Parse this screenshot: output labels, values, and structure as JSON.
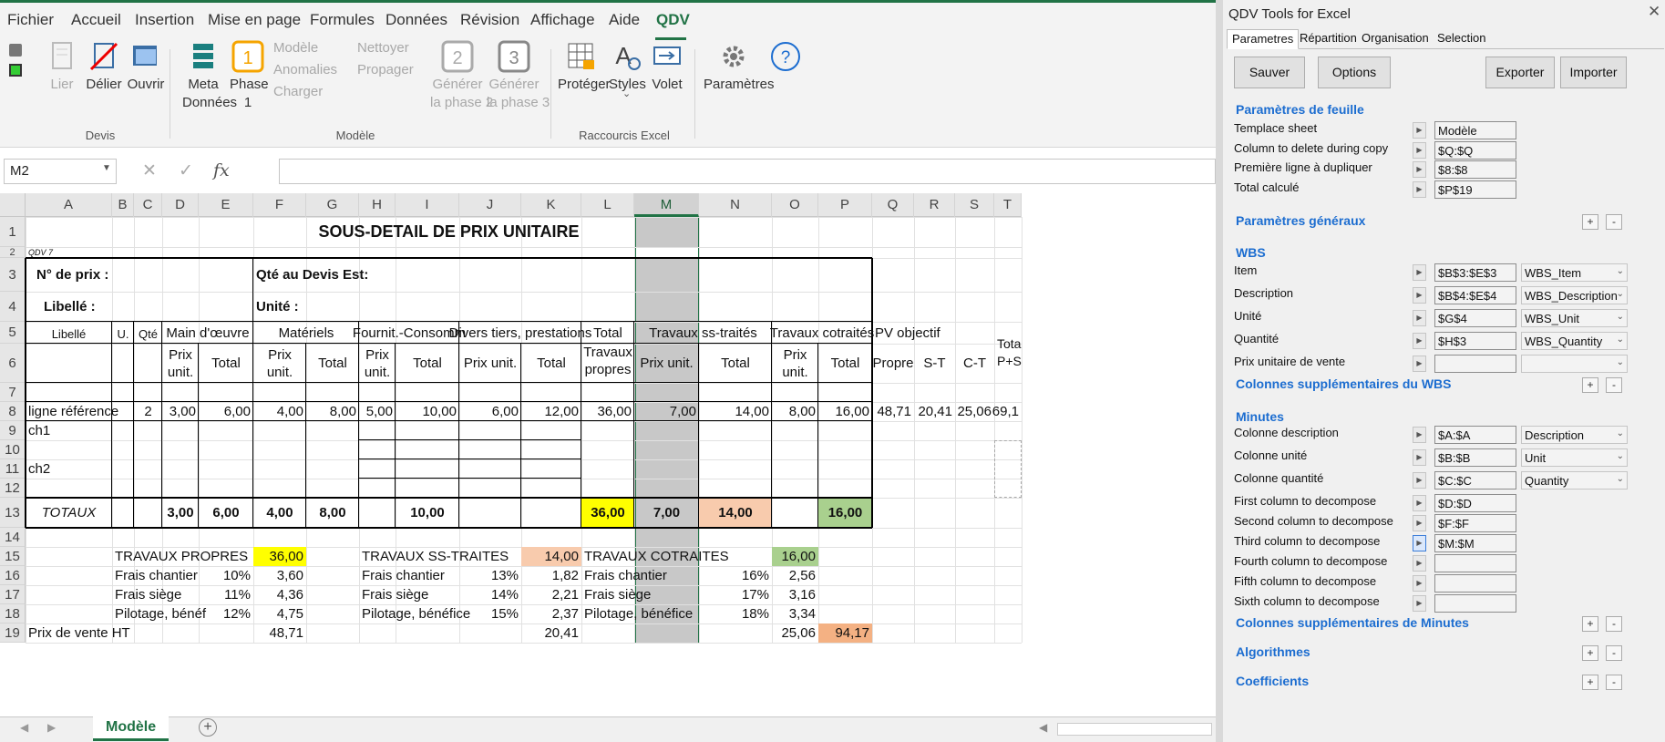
{
  "menu": [
    "Fichier",
    "Accueil",
    "Insertion",
    "Mise en page",
    "Formules",
    "Données",
    "Révision",
    "Affichage",
    "Aide",
    "QDV"
  ],
  "ribbon": {
    "lier": "Lier",
    "delier": "Délier",
    "ouvrir": "Ouvrir",
    "meta": "Meta",
    "donnees": "Données",
    "phase": "Phase",
    "phase_num": "1",
    "phase_icon_num": "1",
    "modele": "Modèle",
    "anomalies": "Anomalies",
    "charger": "Charger",
    "nettoyer": "Nettoyer",
    "propager": "Propager",
    "gen2_a": "Générer",
    "gen2_b": "la phase 2",
    "gen2_icon": "2",
    "gen3_a": "Générer",
    "gen3_b": "la phase 3",
    "gen3_icon": "3",
    "proteger": "Protéger",
    "styles": "Styles",
    "volet": "Volet",
    "parametres": "Paramètres",
    "grp_devis": "Devis",
    "grp_modele": "Modèle",
    "grp_raccourcis": "Raccourcis Excel"
  },
  "formula": {
    "name_box": "M2",
    "fx": "fx",
    "value": ""
  },
  "columns": [
    "A",
    "B",
    "C",
    "D",
    "E",
    "F",
    "G",
    "H",
    "I",
    "J",
    "K",
    "L",
    "M",
    "N",
    "O",
    "P",
    "Q",
    "R",
    "S",
    "T"
  ],
  "rows": [
    "1",
    "2",
    "3",
    "4",
    "5",
    "6",
    "7",
    "8",
    "9",
    "10",
    "11",
    "12",
    "13",
    "14",
    "15",
    "16",
    "17",
    "18",
    "19"
  ],
  "sheet": {
    "title": "SOUS-DETAIL DE PRIX UNITAIRE",
    "qdv": "QDV 7",
    "no_prix": "N° de prix :",
    "qte_devis": "Qté au Devis Est:",
    "libelle_lbl": "Libellé :",
    "unite_lbl": "Unité :",
    "h_main": "Main d'œuvre",
    "h_mat": "Matériels",
    "h_fourn": "Fournit.-Consomm",
    "h_divers": "Divers tiers, prestations",
    "h_total": "Total",
    "h_total2": "Travaux propres",
    "h_travaux_st": "Travaux ss-traités",
    "h_travaux_cot": "Travaux cotraités",
    "h_pv": "PV objectif",
    "h_libelle": "Libellé",
    "h_u": "U.",
    "h_qte": "Qté",
    "h_prix_unit": "Prix unit.",
    "h_total_col": "Total",
    "h_propre": "Propre",
    "h_st": "S-T",
    "h_ct": "C-T",
    "h_tot_ps": "Tota P+S",
    "row8": [
      "ligne référence",
      "2",
      "3,00",
      "6,00",
      "4,00",
      "8,00",
      "5,00",
      "10,00",
      "6,00",
      "12,00",
      "36,00",
      "7,00",
      "14,00",
      "8,00",
      "16,00",
      "48,71",
      "20,41",
      "25,06",
      "69,1"
    ],
    "ch1": "ch1",
    "ch2": "ch2",
    "totaux": "TOTAUX",
    "row13": [
      "3,00",
      "6,00",
      "4,00",
      "8,00",
      "10,00",
      "36,00",
      "7,00",
      "14,00",
      "16,00"
    ],
    "s_tp": "TRAVAUX PROPRES",
    "s_tp_val": "36,00",
    "s_tst": "TRAVAUX SS-TRAITES",
    "s_tst_val": "14,00",
    "s_tct": "TRAVAUX COTRAITES",
    "s_tct_val": "16,00",
    "frais_chantier": "Frais chantier",
    "frais_siege": "Frais siège",
    "pilotage1": "Pilotage, bénéf",
    "pilotage2": "Pilotage, bénéfice",
    "p16": [
      "10%",
      "3,60",
      "13%",
      "1,82",
      "16%",
      "2,56"
    ],
    "p17": [
      "11%",
      "4,36",
      "14%",
      "2,21",
      "17%",
      "3,16"
    ],
    "p18": [
      "12%",
      "4,75",
      "15%",
      "2,37",
      "18%",
      "3,34"
    ],
    "pv_ht": "Prix de vente HT",
    "pv1": "48,71",
    "pv2": "20,41",
    "pv3": "25,06",
    "pv_total": "94,17"
  },
  "tab": {
    "name": "Modèle"
  },
  "panel": {
    "title": "QDV Tools for Excel",
    "tabs": [
      "Parametres",
      "Répartition",
      "Organisation",
      "Selection"
    ],
    "btn_sauver": "Sauver",
    "btn_options": "Options",
    "btn_exporter": "Exporter",
    "btn_importer": "Importer",
    "sec_feuille": "Paramètres de feuille",
    "feuille": [
      [
        "Templace sheet",
        "Modèle"
      ],
      [
        "Column to delete during copy",
        "$Q:$Q"
      ],
      [
        "Première ligne à dupliquer",
        "$8:$8"
      ],
      [
        "Total calculé",
        "$P$19"
      ]
    ],
    "sec_generaux": "Paramètres généraux",
    "sec_wbs": "WBS",
    "wbs": [
      [
        "Item",
        "$B$3:$E$3",
        "WBS_Item"
      ],
      [
        "Description",
        "$B$4:$E$4",
        "WBS_Description"
      ],
      [
        "Unité",
        "$G$4",
        "WBS_Unit"
      ],
      [
        "Quantité",
        "$H$3",
        "WBS_Quantity"
      ],
      [
        "Prix unitaire de vente",
        "",
        ""
      ]
    ],
    "sec_col_wbs": "Colonnes supplémentaires du WBS",
    "sec_minutes": "Minutes",
    "minutes": [
      [
        "Colonne description",
        "$A:$A",
        "Description"
      ],
      [
        "Colonne unité",
        "$B:$B",
        "Unit"
      ],
      [
        "Colonne quantité",
        "$C:$C",
        "Quantity"
      ]
    ],
    "decomp": [
      [
        "First column to decompose",
        "$D:$D"
      ],
      [
        "Second column to decompose",
        "$F:$F"
      ],
      [
        "Third column to decompose",
        "$M:$M"
      ],
      [
        "Fourth column to decompose",
        ""
      ],
      [
        "Fifth column to decompose",
        ""
      ],
      [
        "Sixth column to decompose",
        ""
      ]
    ],
    "sec_col_min": "Colonnes supplémentaires de Minutes",
    "sec_algo": "Algorithmes",
    "sec_coef": "Coefficients"
  },
  "colors": {
    "accent": "#217346",
    "yellow": "#ffff00",
    "salmon": "#f8cbad",
    "green": "#a9d08e",
    "orange": "#f4b183",
    "link": "#1c6dd0",
    "selected_col": "#c8c8c8"
  }
}
